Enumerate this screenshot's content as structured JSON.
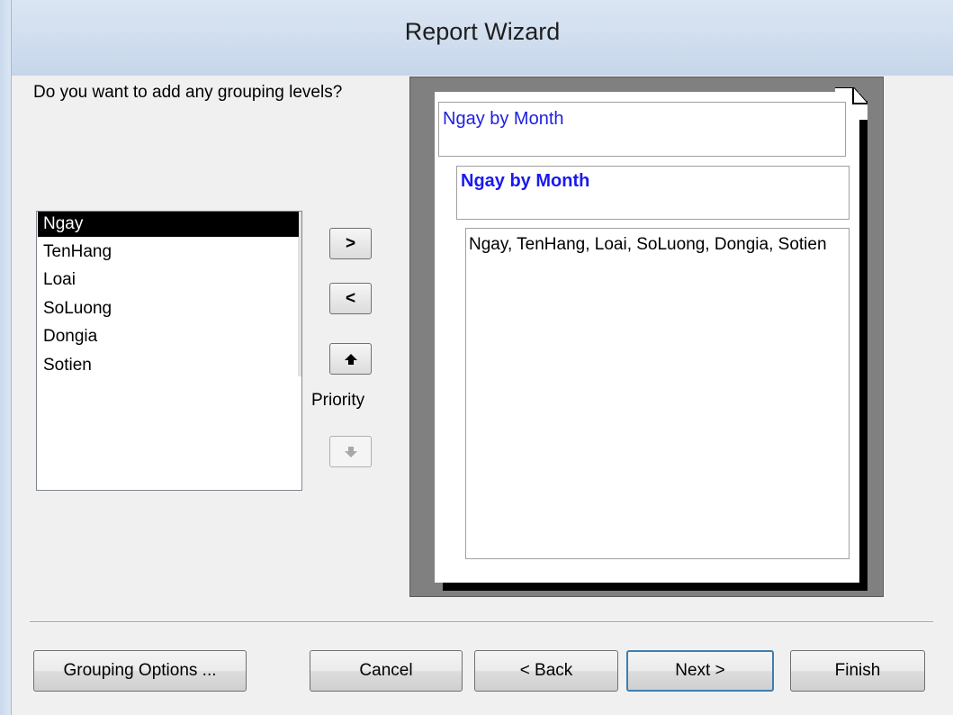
{
  "window": {
    "title": "Report Wizard"
  },
  "prompt": {
    "question": "Do you want to add any grouping levels?"
  },
  "fields_list": {
    "items": [
      "Ngay",
      "TenHang",
      "Loai",
      "SoLuong",
      "Dongia",
      "Sotien"
    ],
    "selected": "Ngay"
  },
  "mover_buttons": {
    "add_label": ">",
    "remove_label": "<",
    "priority_label": "Priority"
  },
  "preview": {
    "header_text": "Ngay by Month",
    "group_text": "Ngay by Month",
    "detail_text": "Ngay, TenHang, Loai, SoLuong, Dongia, Sotien"
  },
  "buttons": {
    "grouping_options": "Grouping Options ...",
    "cancel": "Cancel",
    "back": "< Back",
    "next": "Next >",
    "finish": "Finish"
  },
  "colors": {
    "selection": "#000000",
    "preview_header_text": "#2020e0",
    "preview_group_text": "#1a1af0",
    "default_button_border": "#3c7fb1"
  }
}
